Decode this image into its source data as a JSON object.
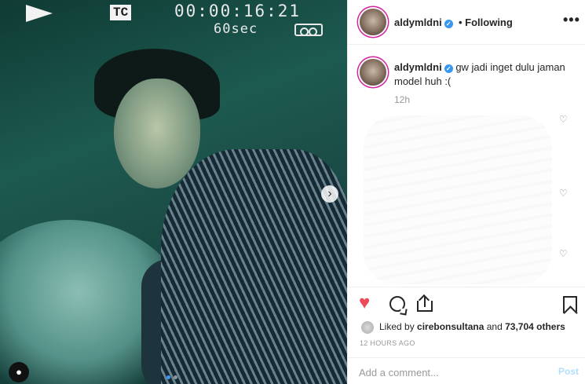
{
  "photo": {
    "vcr_tc": "TC",
    "vcr_time": "00:00:16:21",
    "vcr_speed": "60sec",
    "carousel_dots": 2,
    "carousel_active_index": 1
  },
  "header": {
    "username": "aldymldni",
    "follow_label": "• Following",
    "more_label": "•••"
  },
  "caption": {
    "username": "aldymldni",
    "text": "gw jadi inget dulu jaman model huh :(",
    "time": "12h"
  },
  "actions": {
    "liked_prefix": "Liked by ",
    "liked_user": "cirebonsultana",
    "liked_middle": " and ",
    "liked_count": "73,704 others",
    "post_time": "12 HOURS AGO"
  },
  "comment_box": {
    "placeholder": "Add a comment...",
    "post_label": "Post"
  },
  "colors": {
    "liked_heart": "#ed4956",
    "verified_badge": "#3897f0",
    "post_button_disabled": "#b2dffc"
  }
}
